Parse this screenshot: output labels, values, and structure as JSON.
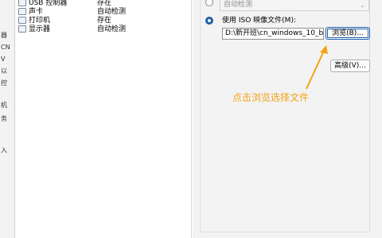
{
  "left_strip": {
    "glyphs": [
      "器",
      "CN",
      "V",
      "以",
      "控",
      "机",
      "务",
      "入"
    ]
  },
  "hardware": {
    "rows": [
      {
        "name": "USB 控制器",
        "status": "存在"
      },
      {
        "name": "声卡",
        "status": "自动检测"
      },
      {
        "name": "打印机",
        "status": "存在"
      },
      {
        "name": "显示器",
        "status": "自动检测"
      }
    ]
  },
  "cd": {
    "auto_detect_placeholder": "自动检测",
    "iso_label": "使用 ISO 映像文件(M):",
    "iso_path": "D:\\新开班\\cn_windows_10_bus",
    "browse_label": "浏览(B)...",
    "advanced_label": "高级(V)..."
  },
  "annotation": {
    "text": "点击浏览选择文件",
    "color": "#f0a416"
  },
  "colors": {
    "accent": "#1f5fa8",
    "annotation": "#f0a416"
  }
}
